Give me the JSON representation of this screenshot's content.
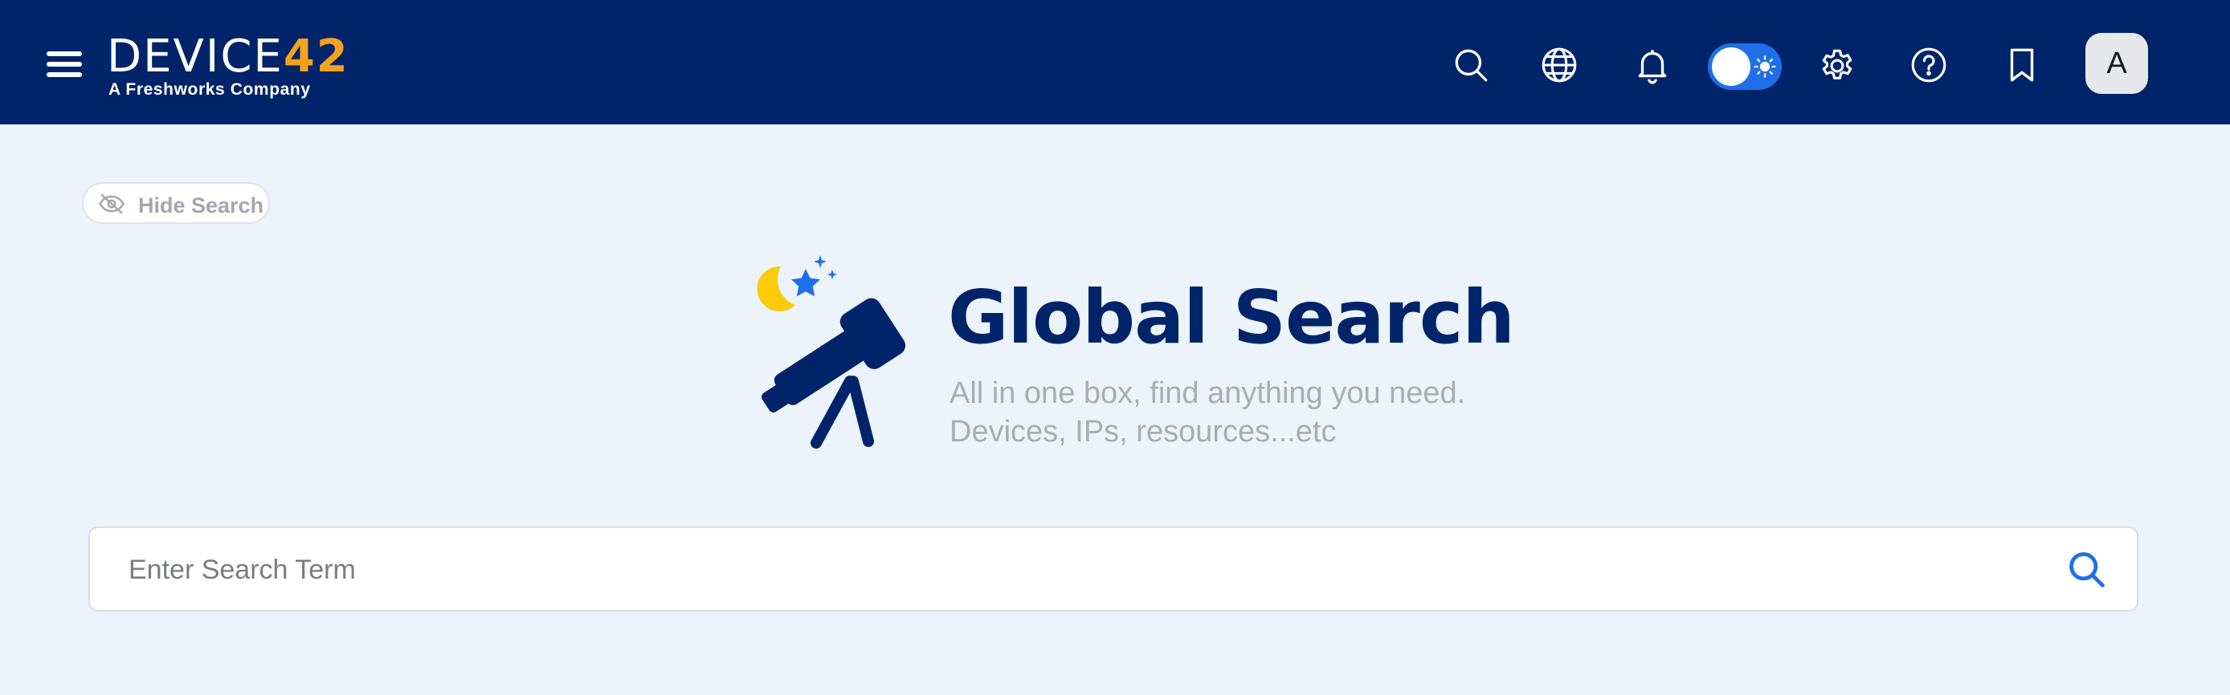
{
  "header": {
    "logo": {
      "word_main": "DEVICE",
      "word_accent": "42",
      "tagline": "A Freshworks Company"
    },
    "icons": [
      "menu-icon",
      "search-icon",
      "globe-icon",
      "bell-icon",
      "theme-toggle",
      "gear-icon",
      "help-icon",
      "bookmark-icon"
    ],
    "avatar_initial": "A"
  },
  "hide_search": {
    "label": "Hide Search",
    "icon": "eye-off-icon"
  },
  "hero": {
    "title": "Global Search",
    "subtitle_line1": "All in one box, find anything you need.",
    "subtitle_line2": "Devices, IPs, resources...etc",
    "illustration": "telescope-icon"
  },
  "search": {
    "placeholder": "Enter Search Term",
    "value": ""
  },
  "colors": {
    "topbar": "#00246a",
    "background": "#ecf3fb",
    "accent": "#1f6fe8",
    "logo_accent": "#f6a21b",
    "title": "#00246a",
    "muted": "#a9acb4",
    "moon": "#fbcb0a"
  }
}
